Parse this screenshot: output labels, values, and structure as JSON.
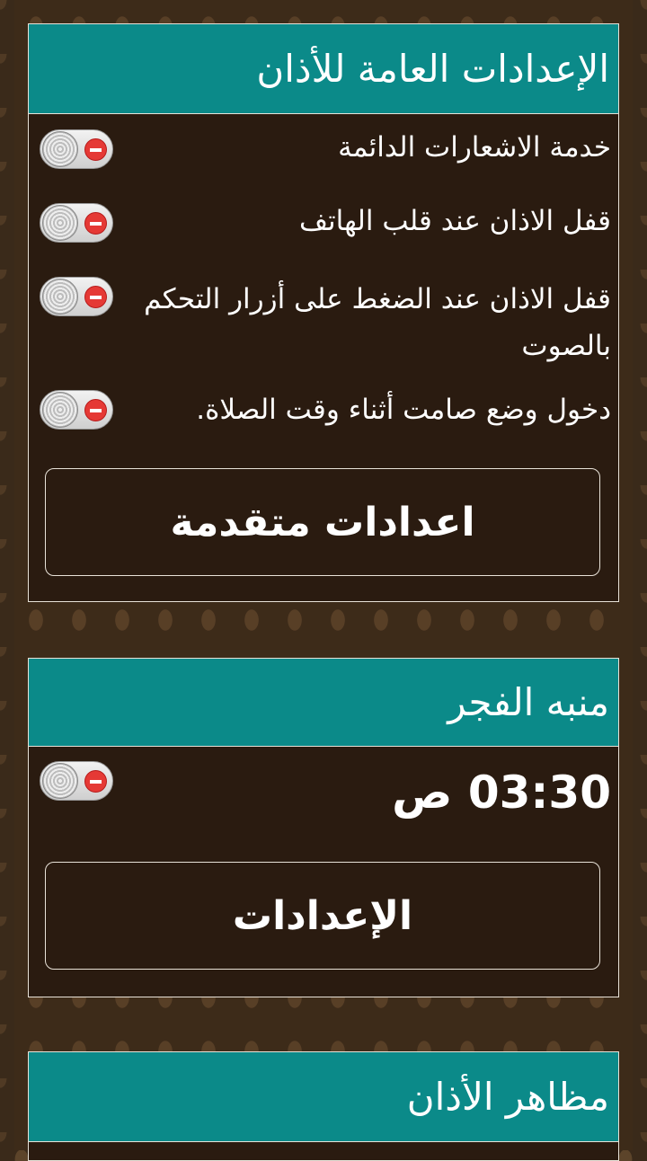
{
  "general_section": {
    "title": "الإعدادات العامة للأذان",
    "settings": [
      {
        "label": "خدمة الاشعارات الدائمة"
      },
      {
        "label": "قفل الاذان عند قلب الهاتف"
      },
      {
        "label": "قفل الاذان عند الضغط على أزرار التحكم بالصوت"
      },
      {
        "label": "دخول وضع صامت أثناء وقت الصلاة."
      }
    ],
    "advanced_button": "اعدادات متقدمة"
  },
  "fajr_alarm": {
    "title": "منبه الفجر",
    "time": "03:30",
    "period": "ص",
    "settings_button": "الإعدادات"
  },
  "athan_appearance": {
    "title": "مظاهر الأذان"
  },
  "colors": {
    "header": "#0b8a89",
    "card_background": "#2a1b10",
    "border": "#e8e2d8",
    "off_indicator": "#e53935"
  }
}
